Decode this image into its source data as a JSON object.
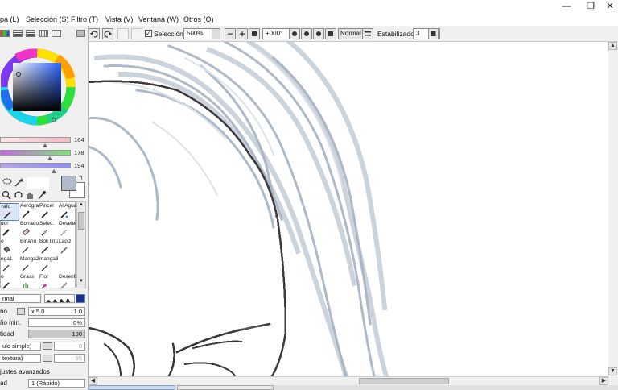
{
  "menu": {
    "items": [
      "pa (L)",
      "Selección (S)",
      "Filtro (T)",
      "Vista (V)",
      "Ventana (W)",
      "Otros (O)"
    ]
  },
  "window": {
    "minimize": "—",
    "restore": "❐",
    "close": "✕"
  },
  "toolbar": {
    "selection_checked": true,
    "selection_label": "Selección",
    "zoom": "500%",
    "rotation": "+000°",
    "blend_mode": "Normal",
    "stabilizer_label": "Estabilizador",
    "stabilizer_value": "3"
  },
  "color": {
    "slider1_value": "164",
    "slider2_value": "178",
    "slider3_value": "194",
    "slider1_fraction": 0.64,
    "slider2_fraction": 0.7,
    "slider3_fraction": 0.76,
    "primary": "#aebbcb",
    "secondary": "#ffffff"
  },
  "tools": [
    {
      "label": "rafc",
      "icon": "pen-icon",
      "selected": true
    },
    {
      "label": "Aerógraf",
      "icon": "airbrush-icon"
    },
    {
      "label": "Pincel",
      "icon": "brush-icon"
    },
    {
      "label": "Al Agua",
      "icon": "watercolor-icon"
    },
    {
      "label": "dor",
      "icon": "marker-icon"
    },
    {
      "label": "Borrador",
      "icon": "eraser-icon"
    },
    {
      "label": "Selec.",
      "icon": "select-brush-icon"
    },
    {
      "label": "Deselec.",
      "icon": "deselect-brush-icon"
    },
    {
      "label": "o",
      "icon": "bucket-icon"
    },
    {
      "label": "Binario",
      "icon": "binary-pen-icon"
    },
    {
      "label": "Boli tinta",
      "icon": "ink-pen-icon"
    },
    {
      "label": "Lapiz",
      "icon": "pencil-icon"
    },
    {
      "label": "nga1",
      "icon": "manga-pen-icon"
    },
    {
      "label": "Manga2",
      "icon": "manga-pen-icon"
    },
    {
      "label": "manga3",
      "icon": "manga-pen-icon"
    },
    {
      "label": "",
      "icon": ""
    },
    {
      "label": "o",
      "icon": "brush-icon"
    },
    {
      "label": "Grass",
      "icon": "grass-icon"
    },
    {
      "label": "Flor",
      "icon": "flower-icon"
    },
    {
      "label": "Desenf.",
      "icon": "blur-icon"
    }
  ],
  "properties": {
    "blend": "rmal",
    "size_label": "ño",
    "size_mult": "x 5.0",
    "size_value": "1.0",
    "min_size_label": "ño min.",
    "min_size_value": "0%",
    "density_label": "tidad",
    "density_value": "100",
    "shape": "ulo simple)",
    "shape_value": "0",
    "texture": "textura)",
    "texture_value": "95",
    "advanced_label": "justes avanzados",
    "quality_label": "ad",
    "quality_value": "1 (Rápido)"
  }
}
